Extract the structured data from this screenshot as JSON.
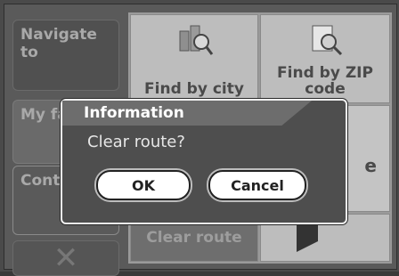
{
  "left_menu": {
    "navigate": "Navigate to",
    "favorites": "My fav",
    "continue": "Cont"
  },
  "tiles": {
    "find_city": "Find by city",
    "find_zip": "Find by ZIP code",
    "clear_route": "Clear route",
    "partial_right": "e"
  },
  "dialog": {
    "title": "Information",
    "message": "Clear route?",
    "ok_label": "OK",
    "cancel_label": "Cancel"
  }
}
